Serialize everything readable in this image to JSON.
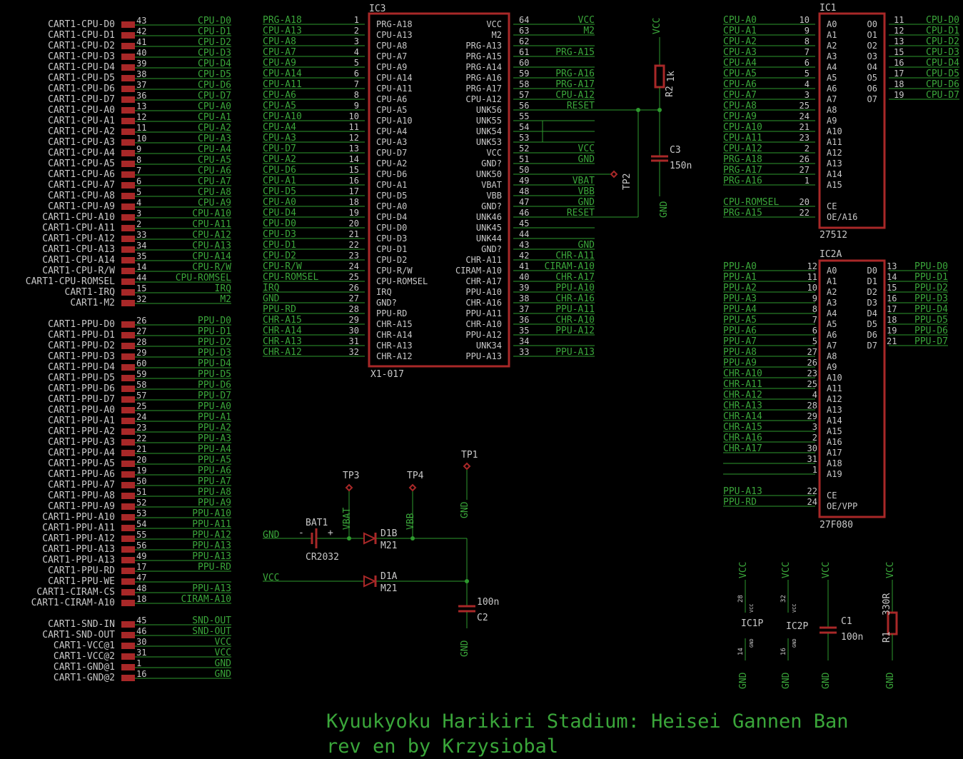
{
  "title": {
    "line1": "Kyuukyoku Harikiri Stadium: Heisei Gannen Ban",
    "line2": "rev en by Krzysiobal"
  },
  "colors": {
    "background": "#000000",
    "wire": "#2e9a2e",
    "part": "#a82828",
    "text": "#c8c8c8",
    "net_label": "#3aa63a"
  },
  "connector": {
    "blocks": [
      [
        [
          "CART1-CPU-D0",
          "43",
          "CPU-D0"
        ],
        [
          "CART1-CPU-D1",
          "42",
          "CPU-D1"
        ],
        [
          "CART1-CPU-D2",
          "41",
          "CPU-D2"
        ],
        [
          "CART1-CPU-D3",
          "40",
          "CPU-D3"
        ],
        [
          "CART1-CPU-D4",
          "39",
          "CPU-D4"
        ],
        [
          "CART1-CPU-D5",
          "38",
          "CPU-D5"
        ],
        [
          "CART1-CPU-D6",
          "37",
          "CPU-D6"
        ],
        [
          "CART1-CPU-D7",
          "36",
          "CPU-D7"
        ],
        [
          "CART1-CPU-A0",
          "13",
          "CPU-A0"
        ],
        [
          "CART1-CPU-A1",
          "12",
          "CPU-A1"
        ],
        [
          "CART1-CPU-A2",
          "11",
          "CPU-A2"
        ],
        [
          "CART1-CPU-A3",
          "10",
          "CPU-A3"
        ],
        [
          "CART1-CPU-A4",
          "9",
          "CPU-A4"
        ],
        [
          "CART1-CPU-A5",
          "8",
          "CPU-A5"
        ],
        [
          "CART1-CPU-A6",
          "7",
          "CPU-A6"
        ],
        [
          "CART1-CPU-A7",
          "6",
          "CPU-A7"
        ],
        [
          "CART1-CPU-A8",
          "5",
          "CPU-A8"
        ],
        [
          "CART1-CPU-A9",
          "4",
          "CPU-A9"
        ],
        [
          "CART1-CPU-A10",
          "3",
          "CPU-A10"
        ],
        [
          "CART1-CPU-A11",
          "2",
          "CPU-A11"
        ],
        [
          "CART1-CPU-A12",
          "33",
          "CPU-A12"
        ],
        [
          "CART1-CPU-A13",
          "34",
          "CPU-A13"
        ],
        [
          "CART1-CPU-A14",
          "35",
          "CPU-A14"
        ],
        [
          "CART1-CPU-R/W",
          "14",
          "CPU-R/W"
        ],
        [
          "CART1-CPU-ROMSEL",
          "44",
          "CPU-ROMSEL"
        ],
        [
          "CART1-IRQ",
          "15",
          "IRQ"
        ],
        [
          "CART1-M2",
          "32",
          "M2"
        ]
      ],
      [
        [
          "CART1-PPU-D0",
          "26",
          "PPU-D0"
        ],
        [
          "CART1-PPU-D1",
          "27",
          "PPU-D1"
        ],
        [
          "CART1-PPU-D2",
          "28",
          "PPU-D2"
        ],
        [
          "CART1-PPU-D3",
          "29",
          "PPU-D3"
        ],
        [
          "CART1-PPU-D4",
          "60",
          "PPU-D4"
        ],
        [
          "CART1-PPU-D5",
          "59",
          "PPU-D5"
        ],
        [
          "CART1-PPU-D6",
          "58",
          "PPU-D6"
        ],
        [
          "CART1-PPU-D7",
          "57",
          "PPU-D7"
        ],
        [
          "CART1-PPU-A0",
          "25",
          "PPU-A0"
        ],
        [
          "CART1-PPU-A1",
          "24",
          "PPU-A1"
        ],
        [
          "CART1-PPU-A2",
          "23",
          "PPU-A2"
        ],
        [
          "CART1-PPU-A3",
          "22",
          "PPU-A3"
        ],
        [
          "CART1-PPU-A4",
          "21",
          "PPU-A4"
        ],
        [
          "CART1-PPU-A5",
          "20",
          "PPU-A5"
        ],
        [
          "CART1-PPU-A6",
          "19",
          "PPU-A6"
        ],
        [
          "CART1-PPU-A7",
          "50",
          "PPU-A7"
        ],
        [
          "CART1-PPU-A8",
          "51",
          "PPU-A8"
        ],
        [
          "CART1-PPU-A9",
          "52",
          "PPU-A9"
        ],
        [
          "CART1-PPU-A10",
          "53",
          "PPU-A10"
        ],
        [
          "CART1-PPU-A11",
          "54",
          "PPU-A11"
        ],
        [
          "CART1-PPU-A12",
          "55",
          "PPU-A12"
        ],
        [
          "CART1-PPU-A13",
          "56",
          "PPU-A13"
        ],
        [
          "CART1-PPU-A13",
          "49",
          "PPU-A13"
        ],
        [
          "CART1-PPU-RD",
          "17",
          "PPU-RD"
        ],
        [
          "CART1-PPU-WE",
          "47",
          ""
        ],
        [
          "CART1-CIRAM-CS",
          "48",
          "PPU-A13"
        ],
        [
          "CART1-CIRAM-A10",
          "18",
          "CIRAM-A10"
        ]
      ],
      [
        [
          "CART1-SND-IN",
          "45",
          "SND-OUT"
        ],
        [
          "CART1-SND-OUT",
          "46",
          "SND-OUT"
        ],
        [
          "CART1-VCC@1",
          "30",
          "VCC"
        ],
        [
          "CART1-VCC@2",
          "31",
          "VCC"
        ],
        [
          "CART1-GND@1",
          "1",
          "GND"
        ],
        [
          "CART1-GND@2",
          "16",
          "GND"
        ]
      ]
    ]
  },
  "ic3": {
    "name": "IC3",
    "value": "X1-017",
    "left": [
      [
        "PRG-A18",
        "1",
        "PRG-A18"
      ],
      [
        "CPU-A13",
        "2",
        "CPU-A13"
      ],
      [
        "CPU-A8",
        "3",
        "CPU-A8"
      ],
      [
        "CPU-A7",
        "4",
        "CPU-A7"
      ],
      [
        "CPU-A9",
        "5",
        "CPU-A9"
      ],
      [
        "CPU-A14",
        "6",
        "CPU-A14"
      ],
      [
        "CPU-A11",
        "7",
        "CPU-A11"
      ],
      [
        "CPU-A6",
        "8",
        "CPU-A6"
      ],
      [
        "CPU-A5",
        "9",
        "CPU-A5"
      ],
      [
        "CPU-A10",
        "10",
        "CPU-A10"
      ],
      [
        "CPU-A4",
        "11",
        "CPU-A4"
      ],
      [
        "CPU-A3",
        "12",
        "CPU-A3"
      ],
      [
        "CPU-D7",
        "13",
        "CPU-D7"
      ],
      [
        "CPU-A2",
        "14",
        "CPU-A2"
      ],
      [
        "CPU-D6",
        "15",
        "CPU-D6"
      ],
      [
        "CPU-A1",
        "16",
        "CPU-A1"
      ],
      [
        "CPU-D5",
        "17",
        "CPU-D5"
      ],
      [
        "CPU-A0",
        "18",
        "CPU-A0"
      ],
      [
        "CPU-D4",
        "19",
        "CPU-D4"
      ],
      [
        "CPU-D0",
        "20",
        "CPU-D0"
      ],
      [
        "CPU-D3",
        "21",
        "CPU-D3"
      ],
      [
        "CPU-D1",
        "22",
        "CPU-D1"
      ],
      [
        "CPU-D2",
        "23",
        "CPU-D2"
      ],
      [
        "CPU-R/W",
        "24",
        "CPU-R/W"
      ],
      [
        "CPU-ROMSEL",
        "25",
        "CPU-ROMSEL"
      ],
      [
        "IRQ",
        "26",
        "IRQ"
      ],
      [
        "GND",
        "27",
        "GND?"
      ],
      [
        "PPU-RD",
        "28",
        "PPU-RD"
      ],
      [
        "CHR-A15",
        "29",
        "CHR-A15"
      ],
      [
        "CHR-A14",
        "30",
        "CHR-A14"
      ],
      [
        "CHR-A13",
        "31",
        "CHR-A13"
      ],
      [
        "CHR-A12",
        "32",
        "CHR-A12"
      ]
    ],
    "right": [
      [
        "VCC",
        "64",
        "VCC"
      ],
      [
        "M2",
        "63",
        "M2"
      ],
      [
        "PRG-A13",
        "62",
        ""
      ],
      [
        "PRG-A15",
        "61",
        "PRG-A15"
      ],
      [
        "PRG-A14",
        "60",
        ""
      ],
      [
        "PRG-A16",
        "59",
        "PRG-A16"
      ],
      [
        "PRG-A17",
        "58",
        "PRG-A17"
      ],
      [
        "CPU-A12",
        "57",
        "CPU-A12"
      ],
      [
        "UNK56",
        "56",
        "RESET"
      ],
      [
        "UNK55",
        "55",
        ""
      ],
      [
        "UNK54",
        "54",
        ""
      ],
      [
        "UNK53",
        "53",
        ""
      ],
      [
        "VCC",
        "52",
        "VCC"
      ],
      [
        "GND?",
        "51",
        "GND"
      ],
      [
        "UNK50",
        "50",
        ""
      ],
      [
        "VBAT",
        "49",
        "VBAT"
      ],
      [
        "VBB",
        "48",
        "VBB"
      ],
      [
        "GND?",
        "47",
        "GND"
      ],
      [
        "UNK46",
        "46",
        "RESET"
      ],
      [
        "UNK45",
        "45",
        ""
      ],
      [
        "UNK44",
        "44",
        ""
      ],
      [
        "GND?",
        "43",
        "GND"
      ],
      [
        "CHR-A11",
        "42",
        "CHR-A11"
      ],
      [
        "CIRAM-A10",
        "41",
        "CIRAM-A10"
      ],
      [
        "CHR-A17",
        "40",
        "CHR-A17"
      ],
      [
        "PPU-A10",
        "39",
        "PPU-A10"
      ],
      [
        "CHR-A16",
        "38",
        "CHR-A16"
      ],
      [
        "PPU-A11",
        "37",
        "PPU-A11"
      ],
      [
        "CHR-A10",
        "36",
        "CHR-A10"
      ],
      [
        "PPU-A12",
        "35",
        "PPU-A12"
      ],
      [
        "UNK34",
        "34",
        ""
      ],
      [
        "PPU-A13",
        "33",
        "PPU-A13"
      ]
    ]
  },
  "ic1": {
    "name": "IC1",
    "value": "27512",
    "left": [
      [
        "CPU-A0",
        "10",
        "A0"
      ],
      [
        "CPU-A1",
        "9",
        "A1"
      ],
      [
        "CPU-A2",
        "8",
        "A2"
      ],
      [
        "CPU-A3",
        "7",
        "A3"
      ],
      [
        "CPU-A4",
        "6",
        "A4"
      ],
      [
        "CPU-A5",
        "5",
        "A5"
      ],
      [
        "CPU-A6",
        "4",
        "A6"
      ],
      [
        "CPU-A7",
        "3",
        "A7"
      ],
      [
        "CPU-A8",
        "25",
        "A8"
      ],
      [
        "CPU-A9",
        "24",
        "A9"
      ],
      [
        "CPU-A10",
        "21",
        "A10"
      ],
      [
        "CPU-A11",
        "23",
        "A11"
      ],
      [
        "CPU-A12",
        "2",
        "A12"
      ],
      [
        "PRG-A18",
        "26",
        "A13"
      ],
      [
        "PRG-A17",
        "27",
        "A14"
      ],
      [
        "PRG-A16",
        "1",
        "A15"
      ],
      [
        "CPU-ROMSEL",
        "20",
        "CE"
      ],
      [
        "PRG-A15",
        "22",
        "OE/A16"
      ]
    ],
    "right": [
      [
        "O0",
        "11",
        "CPU-D0"
      ],
      [
        "O1",
        "12",
        "CPU-D1"
      ],
      [
        "O2",
        "13",
        "CPU-D2"
      ],
      [
        "O3",
        "15",
        "CPU-D3"
      ],
      [
        "O4",
        "16",
        "CPU-D4"
      ],
      [
        "O5",
        "17",
        "CPU-D5"
      ],
      [
        "O6",
        "18",
        "CPU-D6"
      ],
      [
        "O7",
        "19",
        "CPU-D7"
      ]
    ]
  },
  "ic2": {
    "name": "IC2A",
    "value": "27F080",
    "left": [
      [
        "PPU-A0",
        "12",
        "A0"
      ],
      [
        "PPU-A1",
        "11",
        "A1"
      ],
      [
        "PPU-A2",
        "10",
        "A2"
      ],
      [
        "PPU-A3",
        "9",
        "A3"
      ],
      [
        "PPU-A4",
        "8",
        "A4"
      ],
      [
        "PPU-A5",
        "7",
        "A5"
      ],
      [
        "PPU-A6",
        "6",
        "A6"
      ],
      [
        "PPU-A7",
        "5",
        "A7"
      ],
      [
        "PPU-A8",
        "27",
        "A8"
      ],
      [
        "PPU-A9",
        "26",
        "A9"
      ],
      [
        "CHR-A10",
        "23",
        "A10"
      ],
      [
        "CHR-A11",
        "25",
        "A11"
      ],
      [
        "CHR-A12",
        "4",
        "A12"
      ],
      [
        "CHR-A13",
        "28",
        "A13"
      ],
      [
        "CHR-A14",
        "29",
        "A14"
      ],
      [
        "CHR-A15",
        "3",
        "A15"
      ],
      [
        "CHR-A16",
        "2",
        "A16"
      ],
      [
        "CHR-A17",
        "30",
        "A17"
      ],
      [
        "",
        "31",
        "A18"
      ],
      [
        "",
        "1",
        "A19"
      ],
      [
        "PPU-A13",
        "22",
        "CE"
      ],
      [
        "PPU-RD",
        "24",
        "OE/VPP"
      ]
    ],
    "right": [
      [
        "D0",
        "13",
        "PPU-D0"
      ],
      [
        "D1",
        "14",
        "PPU-D1"
      ],
      [
        "D2",
        "15",
        "PPU-D2"
      ],
      [
        "D3",
        "16",
        "PPU-D3"
      ],
      [
        "D4",
        "17",
        "PPU-D4"
      ],
      [
        "D5",
        "18",
        "PPU-D5"
      ],
      [
        "D6",
        "19",
        "PPU-D6"
      ],
      [
        "D7",
        "21",
        "PPU-D7"
      ]
    ]
  },
  "reset": {
    "vcc": "VCC",
    "r2_name": "R2",
    "r2_value": "1k",
    "c3_name": "C3",
    "c3_value": "150n",
    "gnd": "GND",
    "tp2": "TP2"
  },
  "battery": {
    "gnd": "GND",
    "bat_name": "BAT1",
    "bat_value": "CR2032",
    "minus": "-",
    "plus": "+",
    "vbat": "VBAT",
    "tp3": "TP3",
    "tp4": "TP4",
    "vbb": "VBB",
    "tp1": "TP1",
    "tp1_gnd": "GND",
    "d1b": "D1B",
    "d1b_value": "M21",
    "vcc": "VCC",
    "d1a": "D1A",
    "d1a_value": "M21",
    "c2_name": "C2",
    "c2_value": "100n",
    "c2_gnd": "GND"
  },
  "power": {
    "ic1p": {
      "name": "IC1P",
      "vcc": "VCC",
      "gnd": "GND",
      "vcc_pin": "28",
      "gnd_pin": "14"
    },
    "ic2p": {
      "name": "IC2P",
      "vcc": "VCC",
      "gnd": "GND",
      "vcc_pin": "32",
      "gnd_pin": "16"
    },
    "c1": {
      "name": "C1",
      "value": "100n",
      "vcc": "VCC",
      "gnd": "GND"
    },
    "r1": {
      "name": "R1",
      "value": "330R",
      "vcc": "VCC",
      "gnd": "GND"
    }
  }
}
